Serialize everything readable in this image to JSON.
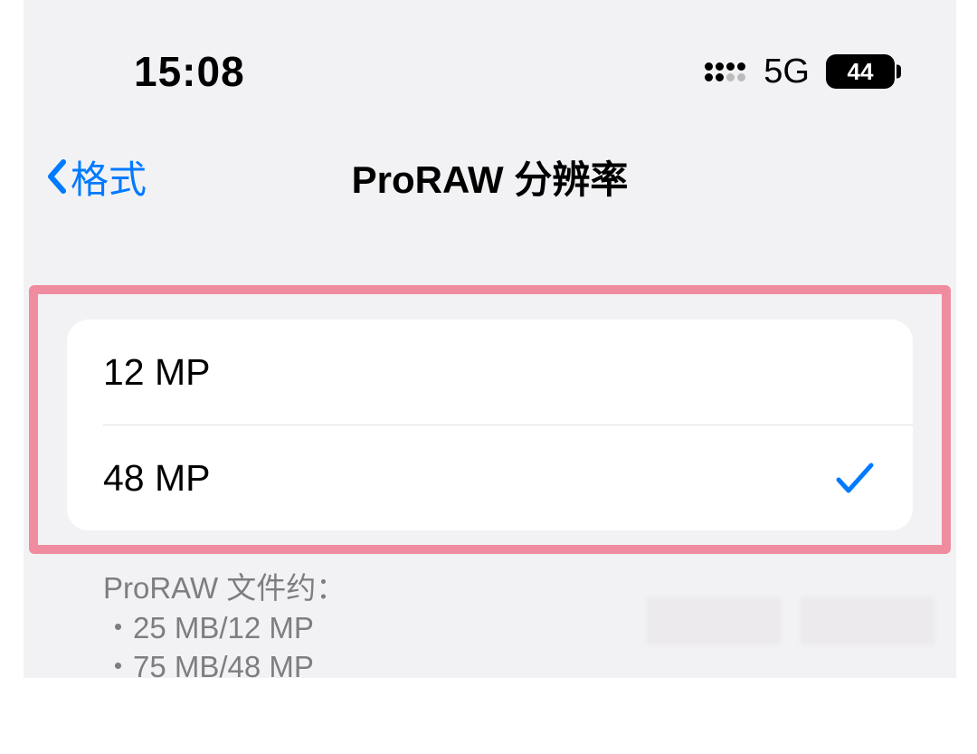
{
  "status": {
    "time": "15:08",
    "network": "5G",
    "battery": "44"
  },
  "nav": {
    "back_label": "格式",
    "title": "ProRAW 分辨率"
  },
  "options": [
    {
      "label": "12 MP",
      "selected": false
    },
    {
      "label": "48 MP",
      "selected": true
    }
  ],
  "footer": {
    "heading": "ProRAW 文件约：",
    "lines": [
      "25 MB/12 MP",
      "75 MB/48 MP"
    ]
  }
}
